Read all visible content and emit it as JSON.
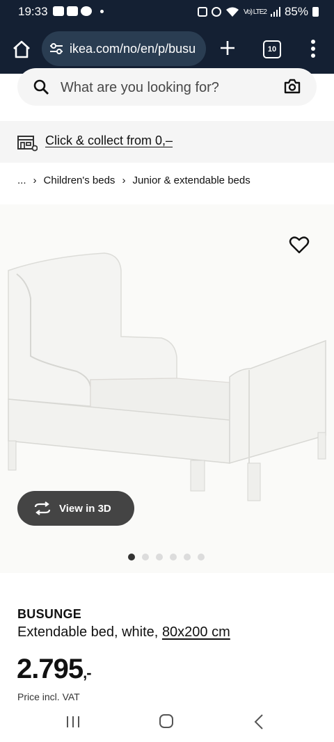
{
  "status_bar": {
    "time": "19:33",
    "battery": "85%",
    "network_label": "Vo) LTE2"
  },
  "browser": {
    "url": "ikea.com/no/en/p/busu",
    "tab_count": "10"
  },
  "search": {
    "placeholder": "What are you looking for?"
  },
  "collect": {
    "label": "Click & collect from 0,–"
  },
  "breadcrumb": {
    "ellipsis": "...",
    "items": [
      "Children's beds",
      "Junior & extendable beds"
    ]
  },
  "gallery": {
    "view3d_label": "View in 3D",
    "dot_count": 6,
    "active_index": 0
  },
  "product": {
    "name": "BUSUNGE",
    "description": "Extendable bed, white,",
    "size": "80x200 cm",
    "price": "2.795",
    "price_suffix": ",-",
    "vat_note": "Price incl. VAT"
  },
  "icons": {
    "home": "home-icon",
    "tune": "site-settings-icon",
    "new_tab": "plus-icon",
    "menu": "more-vert-icon",
    "search": "search-icon",
    "camera": "camera-icon",
    "store": "store-icon",
    "favourite": "heart-icon",
    "rotate": "rotate-3d-icon"
  },
  "colors": {
    "browser_chrome": "#142033",
    "url_pill": "#2a3d52",
    "view3d_button": "#444444"
  }
}
